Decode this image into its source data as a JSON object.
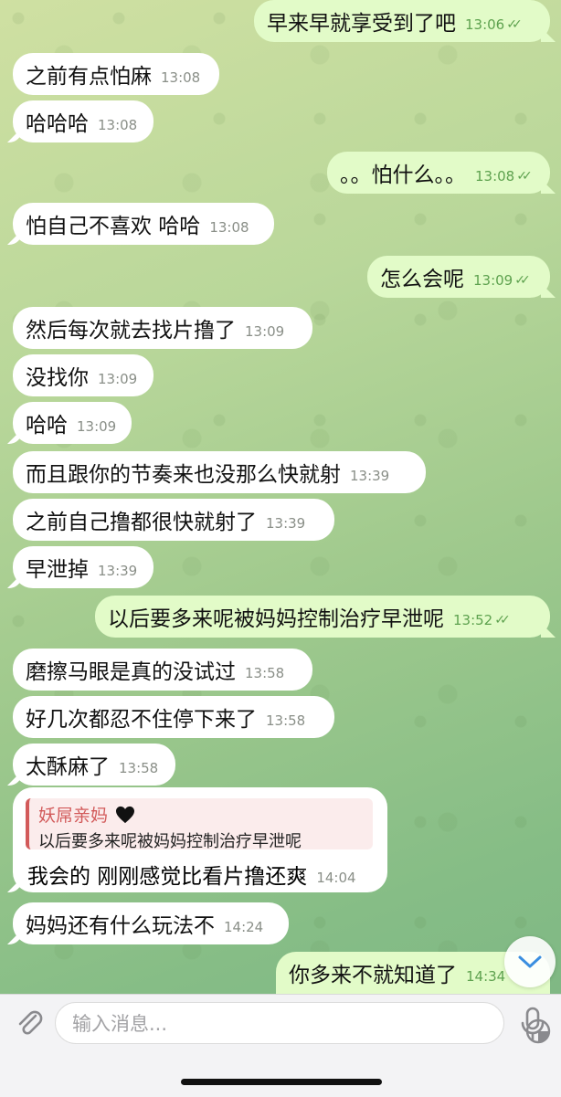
{
  "messages": [
    {
      "text": "早来早就享受到了吧",
      "time": "13:06",
      "dir": "out"
    },
    {
      "text": "之前有点怕麻",
      "time": "13:08",
      "dir": "in"
    },
    {
      "text": "哈哈哈",
      "time": "13:08",
      "dir": "in"
    },
    {
      "text": "。。怕什么。。",
      "time": "13:08",
      "dir": "out"
    },
    {
      "text": "怕自己不喜欢 哈哈",
      "time": "13:08",
      "dir": "in"
    },
    {
      "text": "怎么会呢",
      "time": "13:09",
      "dir": "out"
    },
    {
      "text": "然后每次就去找片撸了",
      "time": "13:09",
      "dir": "in"
    },
    {
      "text": "没找你",
      "time": "13:09",
      "dir": "in"
    },
    {
      "text": "哈哈",
      "time": "13:09",
      "dir": "in"
    },
    {
      "text": "而且跟你的节奏来也没那么快就射",
      "time": "13:39",
      "dir": "in"
    },
    {
      "text": "之前自己撸都很快就射了",
      "time": "13:39",
      "dir": "in"
    },
    {
      "text": "早泄掉",
      "time": "13:39",
      "dir": "in"
    },
    {
      "text": "以后要多来呢被妈妈控制治疗早泄呢",
      "time": "13:52",
      "dir": "out"
    },
    {
      "text": "磨擦马眼是真的没试过",
      "time": "13:58",
      "dir": "in"
    },
    {
      "text": "好几次都忍不住停下来了",
      "time": "13:58",
      "dir": "in"
    },
    {
      "text": "太酥麻了",
      "time": "13:58",
      "dir": "in"
    }
  ],
  "reply": {
    "quote_name": "妖屌亲妈",
    "quote_text": "以后要多来呢被妈妈控制治疗早泄呢",
    "text": "我会的 刚刚感觉比看片撸还爽",
    "time": "14:04"
  },
  "after_reply": [
    {
      "text": "妈妈还有什么玩法不",
      "time": "14:24",
      "dir": "in"
    },
    {
      "text": "你多来不就知道了",
      "time": "14:34",
      "dir": "out"
    }
  ],
  "input": {
    "placeholder": "输入消息..."
  },
  "icons": {
    "attach": "paperclip-icon",
    "sticker": "sticker-icon",
    "mic": "microphone-icon",
    "scroll": "chevron-down-icon",
    "heart": "black-heart-emoji"
  },
  "colors": {
    "incoming": "#ffffff",
    "outgoing": "#e2fbc8",
    "check": "#5ea24f",
    "quote_accent": "#d25a5a"
  }
}
